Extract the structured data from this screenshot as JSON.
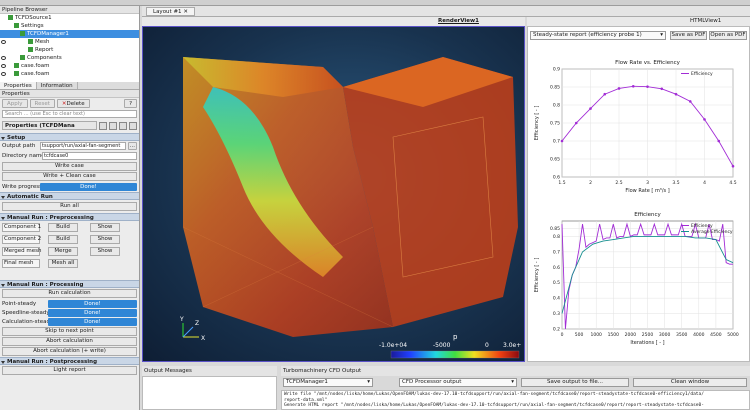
{
  "colors": {
    "selection": "#3d8ee0",
    "done": "#2f86d6",
    "section": "#c9d6e6",
    "series": "#a22cd6",
    "series2": "#178f8f"
  },
  "pipeline_browser": {
    "title": "Pipeline Browser",
    "items": [
      {
        "label": "TCFDSource1",
        "indent": 1
      },
      {
        "label": "Settings",
        "indent": 2
      },
      {
        "label": "TCFDManager1",
        "indent": 3,
        "selected": true
      },
      {
        "label": "Mesh",
        "indent": 4
      },
      {
        "label": "Report",
        "indent": 4
      },
      {
        "label": "Components",
        "indent": 3
      },
      {
        "label": "case.foam",
        "indent": 1
      },
      {
        "label": "case.foam",
        "indent": 1
      }
    ]
  },
  "properties": {
    "panel_title": "Properties",
    "tabs": [
      "Properties",
      "Information"
    ],
    "apply_label": "Apply",
    "reset_label": "Reset",
    "delete_label": "Delete",
    "help_label": "?",
    "search_placeholder": "Search ... (use Esc to clear text)",
    "header_label": "Properties (TCFDMana",
    "setup": {
      "title": "Setup",
      "output_path_label": "Output path",
      "output_path_value": "tsupport/run/axial-fan-segment",
      "browse_label": "...",
      "directory_name_label": "Directory name",
      "directory_name_value": "tcfdcase0",
      "write_case_label": "Write case",
      "write_clean_label": "Write + Clean case",
      "write_progress_label": "Write progress",
      "write_progress_value": "Done!"
    },
    "automatic_run": {
      "title": "Automatic Run",
      "run_all_label": "Run all"
    },
    "preprocessing": {
      "title": "Manual Run : Preprocessing",
      "rows": [
        {
          "label": "Component 1",
          "action": "Build",
          "show": "Show"
        },
        {
          "label": "Component 2",
          "action": "Build",
          "show": "Show"
        },
        {
          "label": "Merged mesh",
          "action": "Merge",
          "show": "Show"
        },
        {
          "label": "Final mesh",
          "action": "Mesh all",
          "show": ""
        }
      ]
    },
    "processing": {
      "title": "Manual Run : Processing",
      "run_calc_label": "Run calculation",
      "rows": [
        {
          "label": "Point-steady",
          "value": "Done!"
        },
        {
          "label": "Speedline-steady",
          "value": "Done!"
        },
        {
          "label": "Calculation-steady",
          "value": "Done!"
        }
      ],
      "skip_label": "Skip to next point",
      "abort_label": "Abort calculation",
      "abort_write_label": "Abort calculation (+ write)"
    },
    "postprocessing": {
      "title": "Manual Run : Postprocessing",
      "light_report_label": "Light report"
    }
  },
  "layout": {
    "tab_label": "Layout #1"
  },
  "render_view": {
    "title": "RenderView1",
    "colorbar": {
      "variable": "p",
      "ticks": [
        "-1.0e+04",
        "-5000",
        "0",
        "3.0e+"
      ]
    },
    "axes": {
      "x": "X",
      "y": "Y",
      "z": "Z"
    }
  },
  "html_view": {
    "title": "HTMLView1",
    "report_select": "Steady-state report (efficiency probe 1)",
    "save_pdf_label": "Save as PDF",
    "open_pdf_label": "Open as PDF"
  },
  "chart_data": [
    {
      "type": "line",
      "title": "Flow Rate  vs. Efficiency",
      "xlabel": "Flow Rate [ m³/s ]",
      "ylabel": "Efficiency [ - ]",
      "legend": "top-right",
      "series": [
        {
          "name": "Efficiency",
          "x": [
            1.5,
            1.75,
            2.0,
            2.25,
            2.5,
            2.75,
            3.0,
            3.25,
            3.5,
            3.75,
            4.0,
            4.25,
            4.5
          ],
          "y": [
            0.7,
            0.75,
            0.79,
            0.83,
            0.846,
            0.852,
            0.851,
            0.845,
            0.83,
            0.81,
            0.76,
            0.7,
            0.63
          ]
        }
      ],
      "xlim": [
        1.5,
        4.5
      ],
      "ylim": [
        0.6,
        0.9
      ],
      "xticks": [
        "1.5",
        "2",
        "2.5",
        "3",
        "3.5",
        "4",
        "4.5"
      ],
      "yticks": [
        "0.6",
        "0.65",
        "0.7",
        "0.75",
        "0.8",
        "0.85",
        "0.9"
      ],
      "grid": true
    },
    {
      "type": "line",
      "title": "Efficiency",
      "xlabel": "Iterations [ - ]",
      "ylabel": "Efficiency [ - ]",
      "legend": "top-right",
      "series": [
        {
          "name": "Efficiency",
          "x": [
            0,
            100,
            200,
            300,
            400,
            500,
            600,
            700,
            800,
            900,
            1000,
            1100,
            1200,
            1300,
            1400,
            1500,
            1600,
            1700,
            1800,
            1900,
            2000,
            2100,
            2200,
            2300,
            2400,
            2500,
            2600,
            2700,
            2800,
            2900,
            3000,
            3100,
            3200,
            3300,
            3400,
            3500,
            3600,
            3700,
            3800,
            3900,
            4000,
            4100,
            4200,
            4300,
            4400,
            4500,
            4600,
            4700,
            4800,
            4900,
            5000
          ],
          "y": [
            0.88,
            0.2,
            0.45,
            0.55,
            0.6,
            0.72,
            0.88,
            0.73,
            0.75,
            0.76,
            0.77,
            0.88,
            0.78,
            0.79,
            0.79,
            0.88,
            0.79,
            0.8,
            0.8,
            0.88,
            0.8,
            0.81,
            0.81,
            0.88,
            0.81,
            0.81,
            0.81,
            0.88,
            0.81,
            0.81,
            0.81,
            0.88,
            0.81,
            0.81,
            0.81,
            0.88,
            0.8,
            0.8,
            0.8,
            0.88,
            0.79,
            0.79,
            0.79,
            0.88,
            0.78,
            0.78,
            0.77,
            0.88,
            0.63,
            0.62,
            0.62
          ]
        },
        {
          "name": "Average Efficiency",
          "x": [
            0,
            300,
            600,
            900,
            1200,
            1500,
            1800,
            2100,
            2400,
            2700,
            3000,
            3300,
            3600,
            3900,
            4200,
            4500,
            4800,
            5000
          ],
          "y": [
            0.3,
            0.55,
            0.7,
            0.75,
            0.77,
            0.78,
            0.79,
            0.8,
            0.8,
            0.8,
            0.8,
            0.8,
            0.8,
            0.79,
            0.79,
            0.78,
            0.65,
            0.63
          ]
        }
      ],
      "xlim": [
        0,
        5000
      ],
      "ylim": [
        0.2,
        0.9
      ],
      "xticks": [
        "0",
        "500",
        "1000",
        "1500",
        "2000",
        "2500",
        "3000",
        "3500",
        "4000",
        "4500",
        "5000"
      ],
      "yticks": [
        "0.2",
        "0.3",
        "0.4",
        "0.5",
        "0.6",
        "0.7",
        "0.8",
        "0.85"
      ],
      "grid": true
    }
  ],
  "output_messages": {
    "title": "Output Messages"
  },
  "cfd_output": {
    "title": "Turbomachinery CFD Output",
    "manager_select": "TCFDManager1",
    "source_select": "CFD Processor output",
    "save_label": "Save output to file...",
    "clean_label": "Clean window",
    "log_lines": [
      "Write file \"/mnt/nodes/liska/home/Lukas/OpenFOAM/lukas-dev-17.10-tcfdsupport/run/axial-fan-segment/tcfdcase0/report-steadystate-tcfdcase0-efficiency1/data/",
      "report-data.xml\"",
      "Generate HTML report \"/mnt/nodes/liska/home/Lukas/OpenFOAM/lukas-dev-17.10-tcfdsupport/run/axial-fan-segment/tcfdcase0/report/report-steadystate-tcfdcase0-"
    ]
  }
}
